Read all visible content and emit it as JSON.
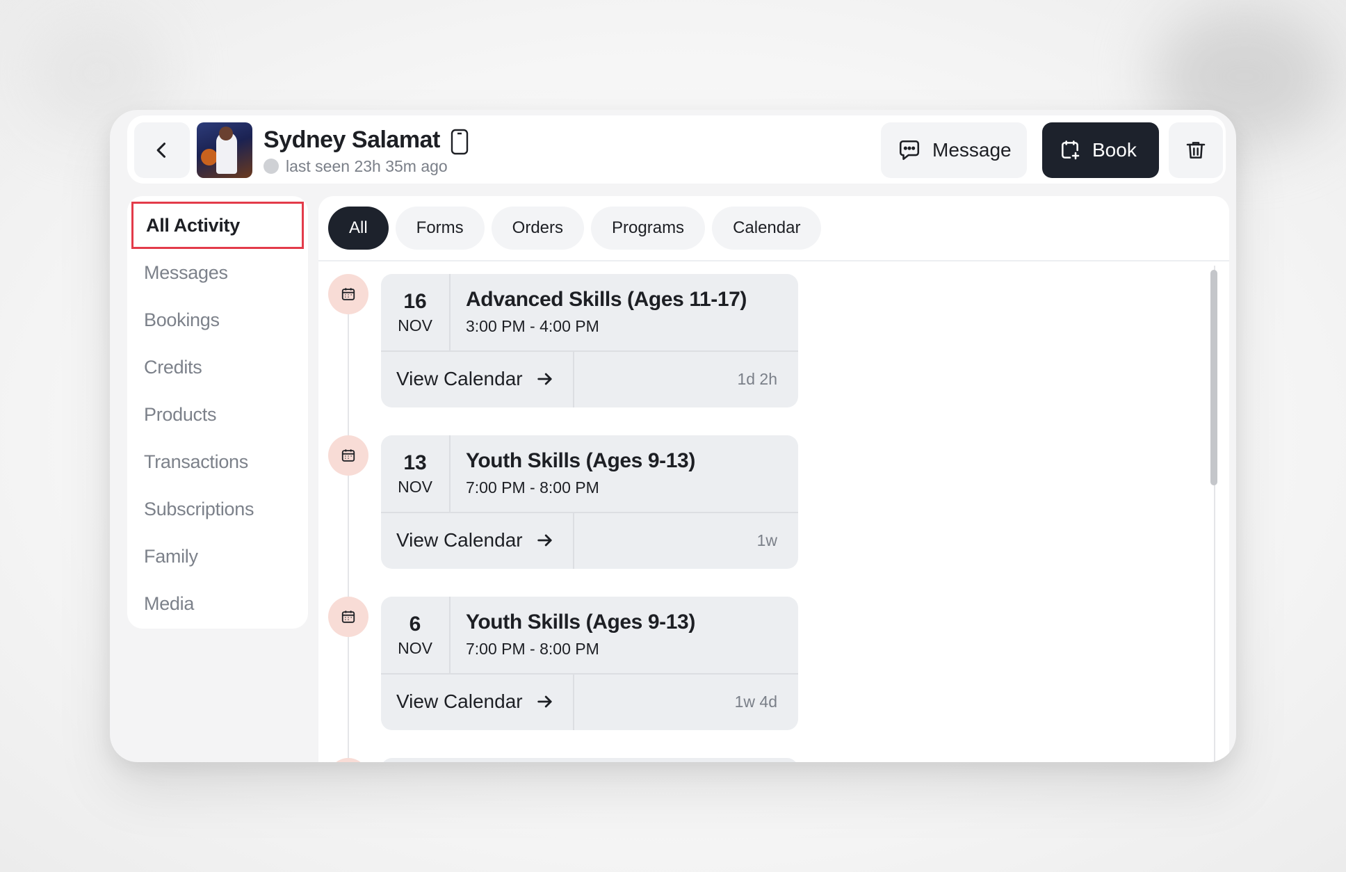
{
  "header": {
    "user_name": "Sydney Salamat",
    "last_seen": "last seen 23h 35m ago",
    "message_label": "Message",
    "book_label": "Book"
  },
  "sidebar": {
    "items": [
      {
        "label": "All Activity",
        "active": true
      },
      {
        "label": "Messages"
      },
      {
        "label": "Bookings"
      },
      {
        "label": "Credits"
      },
      {
        "label": "Products"
      },
      {
        "label": "Transactions"
      },
      {
        "label": "Subscriptions"
      },
      {
        "label": "Family"
      },
      {
        "label": "Media"
      }
    ]
  },
  "tabs": [
    {
      "label": "All",
      "active": true
    },
    {
      "label": "Forms"
    },
    {
      "label": "Orders"
    },
    {
      "label": "Programs"
    },
    {
      "label": "Calendar"
    }
  ],
  "events": [
    {
      "day": "16",
      "month": "NOV",
      "title": "Advanced Skills (Ages 11-17)",
      "time": "3:00 PM - 4:00 PM",
      "action": "View Calendar",
      "ago": "1d 2h"
    },
    {
      "day": "13",
      "month": "NOV",
      "title": "Youth Skills (Ages 9-13)",
      "time": "7:00 PM - 8:00 PM",
      "action": "View Calendar",
      "ago": "1w"
    },
    {
      "day": "6",
      "month": "NOV",
      "title": "Youth Skills (Ages 9-13)",
      "time": "7:00 PM - 8:00 PM",
      "action": "View Calendar",
      "ago": "1w 4d"
    }
  ],
  "colors": {
    "dark": "#1d222c",
    "highlight_border": "#e33b4a",
    "marker_bg": "#f8dcd6",
    "card_bg": "#eceef1"
  },
  "icons": [
    "chevron-left-icon",
    "phone-device-icon",
    "chat-bubble-icon",
    "calendar-plus-icon",
    "trash-icon",
    "calendar-icon",
    "arrow-right-icon"
  ]
}
